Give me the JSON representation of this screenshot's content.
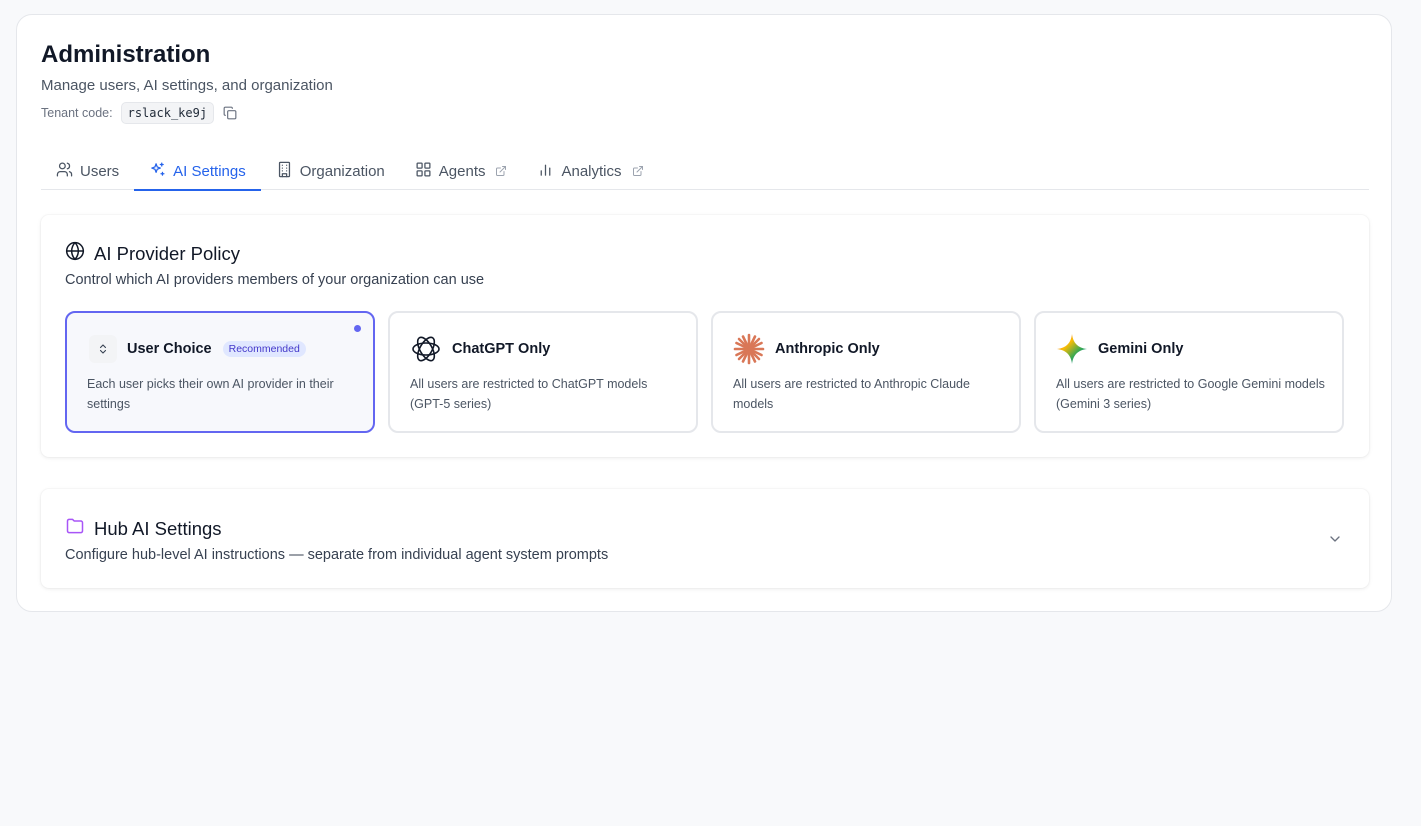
{
  "header": {
    "title": "Administration",
    "subtitle": "Manage users, AI settings, and organization",
    "tenant_label": "Tenant code:",
    "tenant_code": "rslack_ke9j"
  },
  "tabs": [
    {
      "label": "Users",
      "icon": "users-icon",
      "active": false
    },
    {
      "label": "AI Settings",
      "icon": "sparkles-icon",
      "active": true
    },
    {
      "label": "Organization",
      "icon": "building-icon",
      "active": false
    },
    {
      "label": "Agents",
      "icon": "grid-icon",
      "active": false,
      "external": true
    },
    {
      "label": "Analytics",
      "icon": "bar-chart-icon",
      "active": false,
      "external": true
    }
  ],
  "policy": {
    "title": "AI Provider Policy",
    "description": "Control which AI providers members of your organization can use",
    "options": [
      {
        "title": "User Choice",
        "badge": "Recommended",
        "description": "Each user picks their own AI provider in their settings",
        "selected": true
      },
      {
        "title": "ChatGPT Only",
        "description": "All users are restricted to ChatGPT models (GPT-5 series)",
        "selected": false
      },
      {
        "title": "Anthropic Only",
        "description": "All users are restricted to Anthropic Claude models",
        "selected": false
      },
      {
        "title": "Gemini Only",
        "description": "All users are restricted to Google Gemini models (Gemini 3 series)",
        "selected": false
      }
    ]
  },
  "hub": {
    "title": "Hub AI Settings",
    "description": "Configure hub-level AI instructions — separate from individual agent system prompts"
  },
  "colors": {
    "accent": "#2563eb",
    "selection": "#6366f1",
    "anthropic": "#d97757",
    "hub_icon": "#a855f7"
  }
}
